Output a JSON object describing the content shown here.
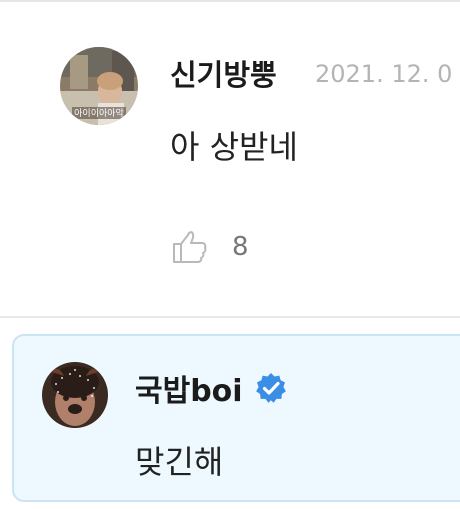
{
  "comment": {
    "author": "신기방뿡",
    "date": "2021. 12. 0",
    "text": "아 상받네",
    "likes": "8",
    "avatar_caption": "아이이아아악"
  },
  "reply": {
    "author": "국밥boi",
    "verified": true,
    "text": "맞긴해"
  },
  "colors": {
    "reply_background": "#eef9ff",
    "reply_border": "#c9e4f3",
    "verified_badge": "#3a8ee6",
    "muted_text": "#b4b4b4"
  },
  "icons": [
    "thumbs-up-icon",
    "verified-badge-icon"
  ]
}
